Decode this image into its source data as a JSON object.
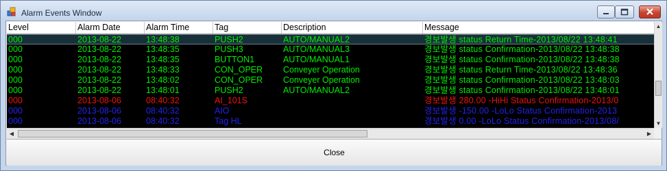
{
  "window": {
    "title": "Alarm Events Window"
  },
  "grid": {
    "columns": [
      "Level",
      "Alarm Date",
      "Alarm Time",
      "Tag",
      "Description",
      "Message"
    ],
    "rows": [
      {
        "level": "000",
        "date": "2013-08-22",
        "time": "13:48:38",
        "tag": "PUSH2",
        "desc": "AUTO/MANUAL2",
        "message": "경보발생    status  Return Time-2013/08/22  13:48:41",
        "color": "#00ee00",
        "selected": true
      },
      {
        "level": "000",
        "date": "2013-08-22",
        "time": "13:48:35",
        "tag": "PUSH3",
        "desc": "AUTO/MANUAL3",
        "message": "경보발생    status  Confirmation-2013/08/22  13:48:38",
        "color": "#00ee00",
        "selected": false
      },
      {
        "level": "000",
        "date": "2013-08-22",
        "time": "13:48:35",
        "tag": "BUTTON1",
        "desc": "AUTO/MANUAL1",
        "message": "경보발생    status  Confirmation-2013/08/22  13:48:38",
        "color": "#00ee00",
        "selected": false
      },
      {
        "level": "000",
        "date": "2013-08-22",
        "time": "13:48:33",
        "tag": "CON_OPER",
        "desc": "Conveyer Operation",
        "message": "경보발생    status  Return Time-2013/08/22  13:48:36",
        "color": "#00ee00",
        "selected": false
      },
      {
        "level": "000",
        "date": "2013-08-22",
        "time": "13:48:02",
        "tag": "CON_OPER",
        "desc": "Conveyer Operation",
        "message": "경보발생    status  Confirmation-2013/08/22  13:48:03",
        "color": "#00ee00",
        "selected": false
      },
      {
        "level": "000",
        "date": "2013-08-22",
        "time": "13:48:01",
        "tag": "PUSH2",
        "desc": "AUTO/MANUAL2",
        "message": "경보발생    status  Confirmation-2013/08/22  13:48:01",
        "color": "#00ee00",
        "selected": false
      },
      {
        "level": "000",
        "date": "2013-08-06",
        "time": "08:40:32",
        "tag": "AI_101S",
        "desc": "",
        "message": "경보발생    280.00   -HiHi  Status  Confirmation-2013/0",
        "color": "#ee1111",
        "selected": false
      },
      {
        "level": "000",
        "date": "2013-08-06",
        "time": "08:40:32",
        "tag": "AIO",
        "desc": "",
        "message": "경보발생    -150.00   -LoLo  Status  Confirmation-2013",
        "color": "#2222ee",
        "selected": false
      },
      {
        "level": "000",
        "date": "2013-08-06",
        "time": "08:40:32",
        "tag": "Tag HL",
        "desc": "",
        "message": "경보발생    0.00   -LoLo  Status  Confirmation-2013/08/",
        "color": "#2222ee",
        "selected": false
      }
    ]
  },
  "buttons": {
    "close_label": "Close"
  }
}
